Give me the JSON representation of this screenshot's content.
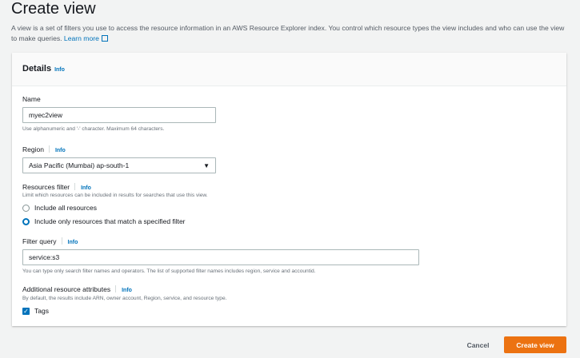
{
  "page": {
    "title": "Create view",
    "description": "A view is a set of filters you use to access the resource information in an AWS Resource Explorer index. You control which resource types the view includes and who can use the view to make queries.",
    "learn_more": "Learn more"
  },
  "details": {
    "title": "Details",
    "info": "Info",
    "name": {
      "label": "Name",
      "value": "myec2view",
      "hint": "Use alphanumeric and '-' character. Maximum 64 characters."
    },
    "region": {
      "label": "Region",
      "info": "Info",
      "value": "Asia Pacific (Mumbai) ap-south-1"
    },
    "resources_filter": {
      "label": "Resources filter",
      "info": "Info",
      "hint": "Limit which resources can be included in results for searches that use this view.",
      "options": [
        {
          "label": "Include all resources",
          "selected": false
        },
        {
          "label": "Include only resources that match a specified filter",
          "selected": true
        }
      ]
    },
    "filter_query": {
      "label": "Filter query",
      "info": "Info",
      "value": "service:s3",
      "hint": "You can type only search filter names and operators. The list of supported filter names includes region, service and accountid."
    },
    "additional": {
      "label": "Additional resource attributes",
      "info": "Info",
      "hint": "By default, the results include ARN, owner account, Region, service, and resource type.",
      "tags_label": "Tags",
      "tags_checked": true
    }
  },
  "actions": {
    "cancel": "Cancel",
    "create": "Create view"
  }
}
